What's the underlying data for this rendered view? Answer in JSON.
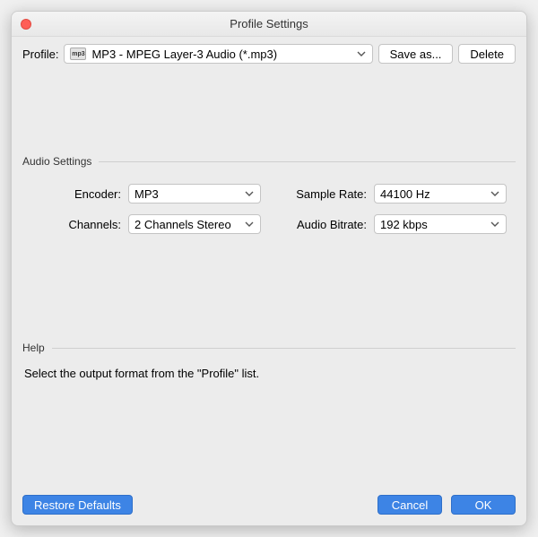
{
  "title": "Profile Settings",
  "topbar": {
    "profile_label": "Profile:",
    "profile_value": "MP3 - MPEG Layer-3 Audio (*.mp3)",
    "profile_icon_text": "mp3",
    "save_as_label": "Save as...",
    "delete_label": "Delete"
  },
  "audio": {
    "legend": "Audio Settings",
    "encoder_label": "Encoder:",
    "encoder_value": "MP3",
    "sample_rate_label": "Sample Rate:",
    "sample_rate_value": "44100 Hz",
    "channels_label": "Channels:",
    "channels_value": "2 Channels Stereo",
    "bitrate_label": "Audio Bitrate:",
    "bitrate_value": "192 kbps"
  },
  "help": {
    "legend": "Help",
    "text": "Select the output format from the \"Profile\" list."
  },
  "footer": {
    "restore_label": "Restore Defaults",
    "cancel_label": "Cancel",
    "ok_label": "OK"
  }
}
